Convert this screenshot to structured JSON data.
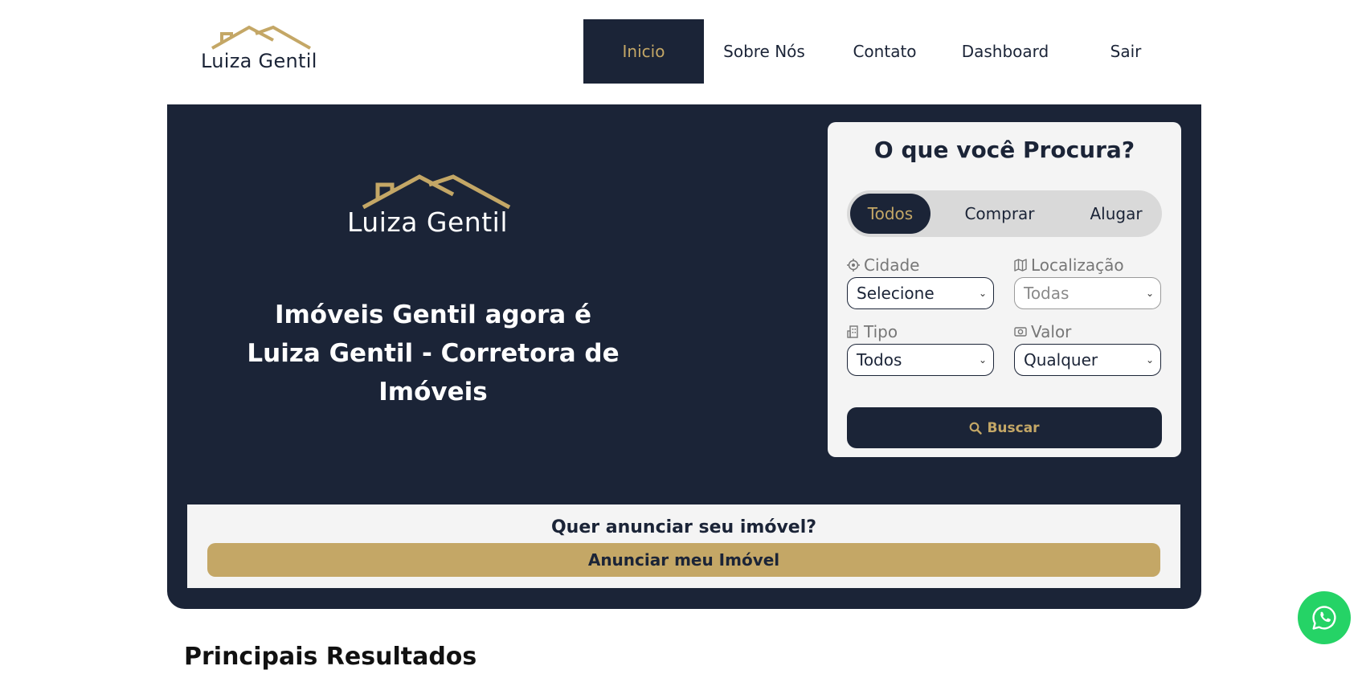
{
  "header": {
    "logo_text": "Luiza Gentil",
    "nav": [
      {
        "label": "Inicio",
        "active": true
      },
      {
        "label": "Sobre Nós",
        "active": false
      },
      {
        "label": "Contato",
        "active": false
      },
      {
        "label": "Dashboard",
        "active": false
      },
      {
        "label": "Sair",
        "active": false
      }
    ]
  },
  "hero": {
    "logo_text": "Luiza Gentil",
    "title": "Imóveis Gentil agora é Luiza Gentil - Corretora de Imóveis"
  },
  "search": {
    "title": "O que você Procura?",
    "segments": [
      {
        "label": "Todos",
        "active": true
      },
      {
        "label": "Comprar",
        "active": false
      },
      {
        "label": "Alugar",
        "active": false
      }
    ],
    "fields": {
      "cidade": {
        "label": "Cidade",
        "value": "Selecione",
        "icon": "location-target-icon"
      },
      "localizacao": {
        "label": "Localização",
        "value": "Todas",
        "icon": "map-icon"
      },
      "tipo": {
        "label": "Tipo",
        "value": "Todos",
        "icon": "building-icon"
      },
      "valor": {
        "label": "Valor",
        "value": "Qualquer",
        "icon": "money-icon"
      }
    },
    "button_label": "Buscar"
  },
  "anunciar": {
    "title": "Quer anunciar seu imóvel?",
    "button_label": "Anunciar meu Imóvel"
  },
  "results": {
    "title": "Principais Resultados"
  },
  "colors": {
    "navy": "#1b2437",
    "gold": "#c4a766",
    "light": "#f4f4f4",
    "whatsapp": "#25d366"
  }
}
